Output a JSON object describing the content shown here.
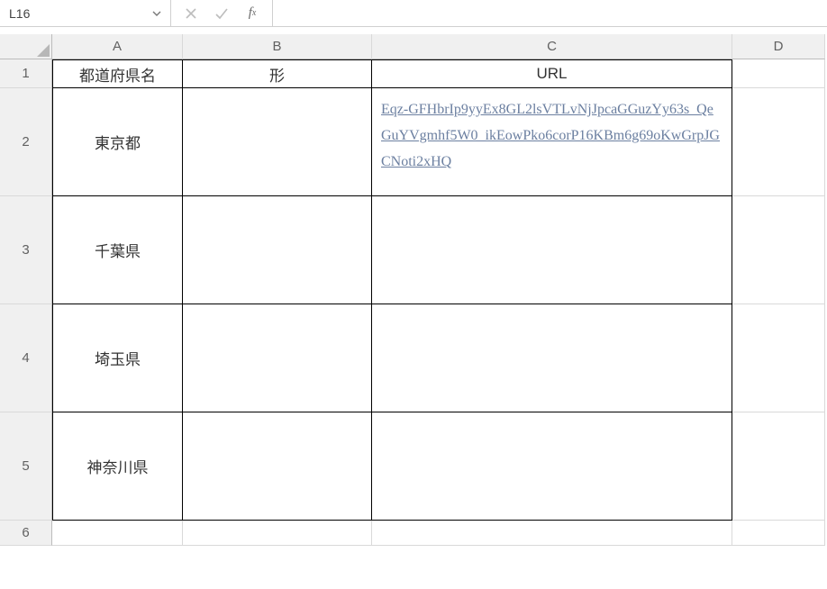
{
  "nameBox": {
    "value": "L16"
  },
  "formulaBar": {
    "value": ""
  },
  "columns": {
    "A": "A",
    "B": "B",
    "C": "C",
    "D": "D"
  },
  "rows": {
    "r1": "1",
    "r2": "2",
    "r3": "3",
    "r4": "4",
    "r5": "5",
    "r6": "6"
  },
  "header": {
    "colA": "都道府県名",
    "colB": "形",
    "colC": "URL"
  },
  "data": [
    {
      "pref": "東京都",
      "shape": "",
      "url": "Eqz-GFHbrIp9yyEx8GL2lsVTLvNjJpcaGGuzYy63s_QeGuYVgmhf5W0_ikEowPko6corP16KBm6g69oKwGrpJGCNoti2xHQ"
    },
    {
      "pref": "千葉県",
      "shape": "",
      "url": ""
    },
    {
      "pref": "埼玉県",
      "shape": "",
      "url": ""
    },
    {
      "pref": "神奈川県",
      "shape": "",
      "url": ""
    }
  ]
}
